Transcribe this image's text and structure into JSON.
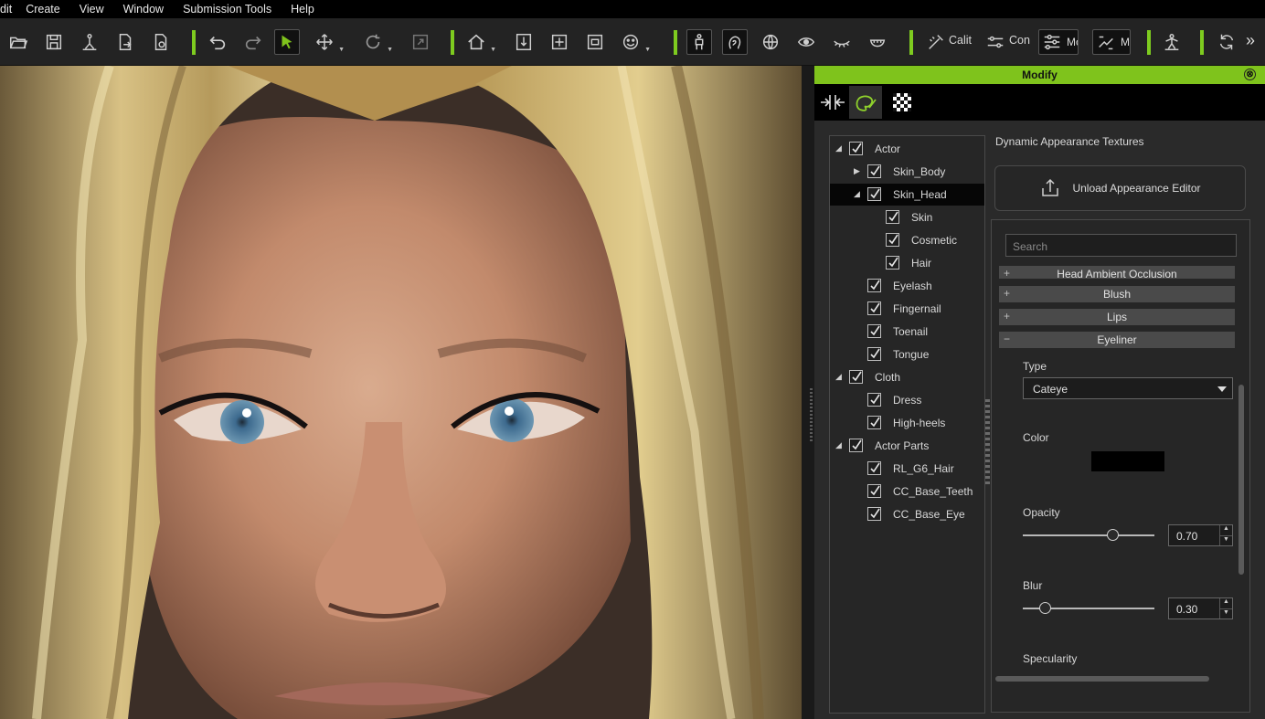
{
  "menu": [
    "dit",
    "Create",
    "View",
    "Window",
    "Submission Tools",
    "Help"
  ],
  "toolbar": {
    "calib_label": "Calit",
    "con_label": "Con",
    "mo_label": "Mo",
    "m_label": "M",
    "more": "»"
  },
  "panel": {
    "title": "Modify",
    "close": "⊗",
    "section_title": "Dynamic Appearance Textures",
    "unload_label": "Unload Appearance Editor",
    "search_placeholder": "Search",
    "tree": [
      {
        "label": "Actor",
        "arrow": "◢",
        "checked": true
      },
      {
        "label": "Skin_Body",
        "arrow": "▶",
        "checked": true
      },
      {
        "label": "Skin_Head",
        "arrow": "◢",
        "checked": true
      },
      {
        "label": "Skin",
        "arrow": "",
        "checked": true
      },
      {
        "label": "Cosmetic",
        "arrow": "",
        "checked": true
      },
      {
        "label": "Hair",
        "arrow": "",
        "checked": true
      },
      {
        "label": "Eyelash",
        "arrow": "",
        "checked": true
      },
      {
        "label": "Fingernail",
        "arrow": "",
        "checked": true
      },
      {
        "label": "Toenail",
        "arrow": "",
        "checked": true
      },
      {
        "label": "Tongue",
        "arrow": "",
        "checked": true
      },
      {
        "label": "Cloth",
        "arrow": "◢",
        "checked": true
      },
      {
        "label": "Dress",
        "arrow": "",
        "checked": true
      },
      {
        "label": "High-heels",
        "arrow": "",
        "checked": true
      },
      {
        "label": "Actor Parts",
        "arrow": "◢",
        "checked": true
      },
      {
        "label": "RL_G6_Hair",
        "arrow": "",
        "checked": true
      },
      {
        "label": "CC_Base_Teeth",
        "arrow": "",
        "checked": true
      },
      {
        "label": "CC_Base_Eye",
        "arrow": "",
        "checked": true
      }
    ],
    "accordions": [
      {
        "label": "Head Ambient Occlusion",
        "sign": "+"
      },
      {
        "label": "Blush",
        "sign": "+"
      },
      {
        "label": "Lips",
        "sign": "+"
      },
      {
        "label": "Eyeliner",
        "sign": "−"
      }
    ],
    "eyeliner": {
      "type_label": "Type",
      "type_value": "Cateye",
      "color_label": "Color",
      "color_value": "#000000",
      "opacity_label": "Opacity",
      "opacity_value": "0.70",
      "opacity_fraction": 0.7,
      "blur_label": "Blur",
      "blur_value": "0.30",
      "blur_fraction": 0.14,
      "specularity_label": "Specularity"
    }
  },
  "colors": {
    "accent": "#7fc31c",
    "panel_bg": "#2a2a2a",
    "menubar_bg": "#000000"
  }
}
